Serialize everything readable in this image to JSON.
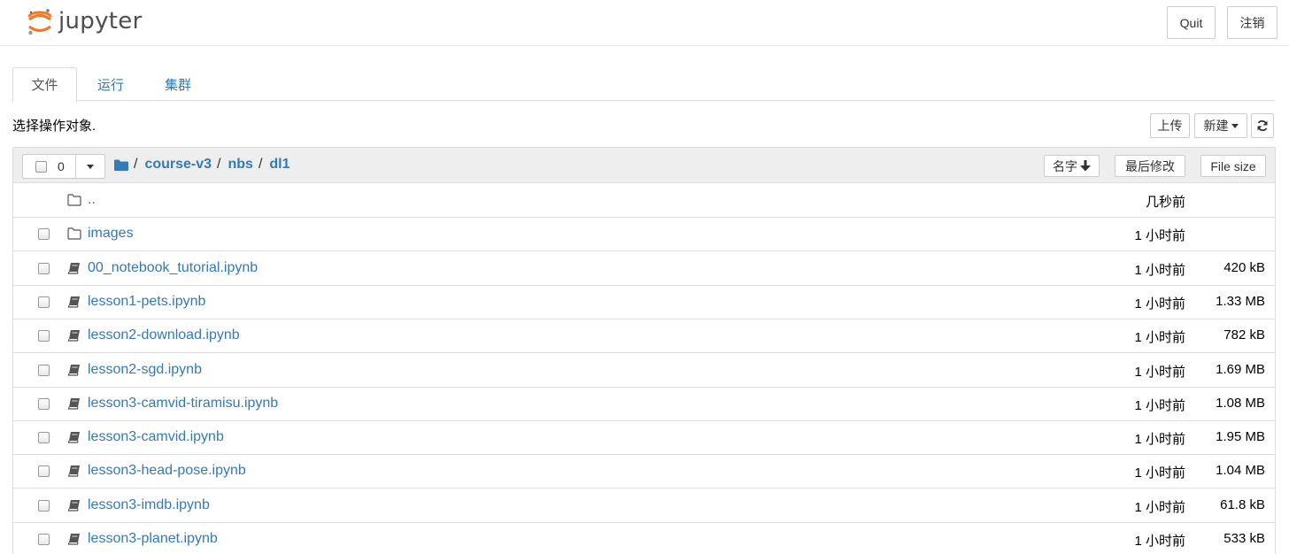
{
  "header": {
    "logo_text": "jupyter",
    "quit_label": "Quit",
    "logout_label": "注销"
  },
  "tabs": [
    {
      "label": "文件",
      "active": true
    },
    {
      "label": "运行",
      "active": false
    },
    {
      "label": "集群",
      "active": false
    }
  ],
  "toolbar": {
    "select_hint": "选择操作对象.",
    "upload_label": "上传",
    "new_label": "新建",
    "refresh_icon": "refresh-icon"
  },
  "list_header": {
    "selected_count": "0",
    "breadcrumb": [
      "course-v3",
      "nbs",
      "dl1"
    ],
    "separator": "/",
    "sort_name_label": "名字",
    "sort_modified_label": "最后修改",
    "sort_size_label": "File size"
  },
  "files": [
    {
      "name": "..",
      "type": "folder",
      "modified": "几秒前",
      "size": "",
      "checkbox": false
    },
    {
      "name": "images",
      "type": "folder",
      "modified": "1 小时前",
      "size": "",
      "checkbox": true
    },
    {
      "name": "00_notebook_tutorial.ipynb",
      "type": "notebook",
      "modified": "1 小时前",
      "size": "420 kB",
      "checkbox": true
    },
    {
      "name": "lesson1-pets.ipynb",
      "type": "notebook",
      "modified": "1 小时前",
      "size": "1.33 MB",
      "checkbox": true
    },
    {
      "name": "lesson2-download.ipynb",
      "type": "notebook",
      "modified": "1 小时前",
      "size": "782 kB",
      "checkbox": true
    },
    {
      "name": "lesson2-sgd.ipynb",
      "type": "notebook",
      "modified": "1 小时前",
      "size": "1.69 MB",
      "checkbox": true
    },
    {
      "name": "lesson3-camvid-tiramisu.ipynb",
      "type": "notebook",
      "modified": "1 小时前",
      "size": "1.08 MB",
      "checkbox": true
    },
    {
      "name": "lesson3-camvid.ipynb",
      "type": "notebook",
      "modified": "1 小时前",
      "size": "1.95 MB",
      "checkbox": true
    },
    {
      "name": "lesson3-head-pose.ipynb",
      "type": "notebook",
      "modified": "1 小时前",
      "size": "1.04 MB",
      "checkbox": true
    },
    {
      "name": "lesson3-imdb.ipynb",
      "type": "notebook",
      "modified": "1 小时前",
      "size": "61.8 kB",
      "checkbox": true
    },
    {
      "name": "lesson3-planet.ipynb",
      "type": "notebook",
      "modified": "1 小时前",
      "size": "533 kB",
      "checkbox": true
    }
  ],
  "colors": {
    "link": "#337ab7",
    "jupyter_orange": "#f37726",
    "header_gray": "#eeeeee",
    "border": "#dddddd"
  }
}
